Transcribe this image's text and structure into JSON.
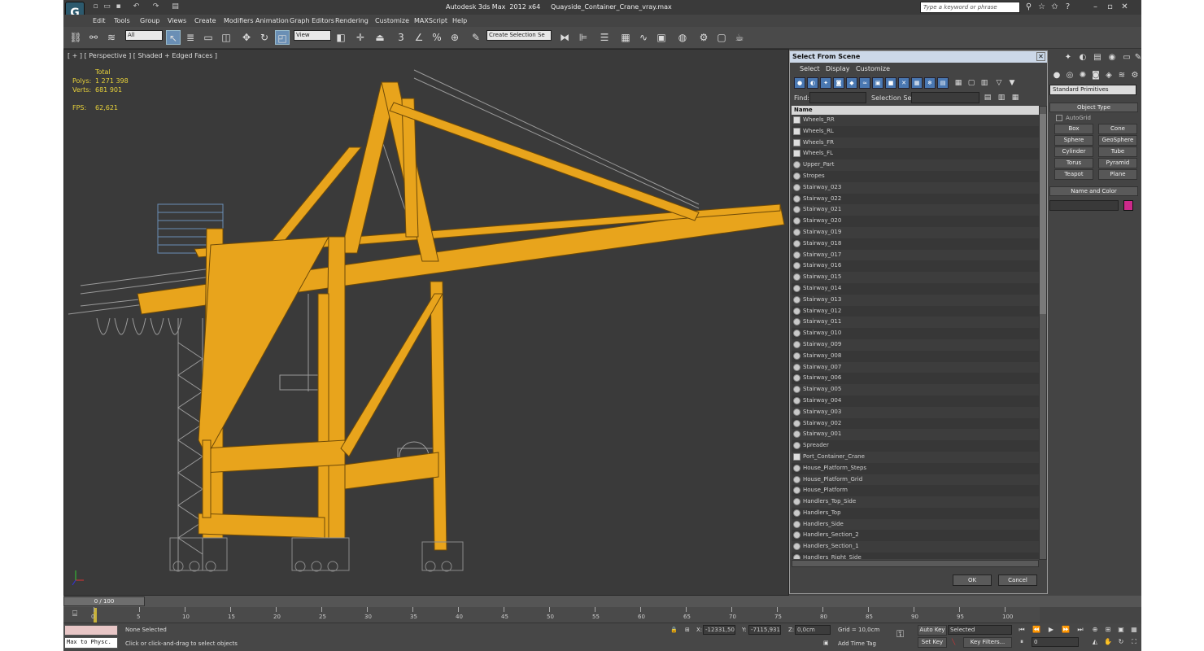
{
  "title": "Autodesk 3ds Max  2012 x64     Quayside_Container_Crane_vray.max",
  "search_placeholder": "Type a keyword or phrase",
  "menu": [
    "Edit",
    "Tools",
    "Group",
    "Views",
    "Create",
    "Modifiers",
    "Animation",
    "Graph Editors",
    "Rendering",
    "Customize",
    "MAXScript",
    "Help"
  ],
  "toolbar": {
    "filter": "All",
    "coord": "View",
    "selection_set": "Create Selection Se"
  },
  "viewport": {
    "label": "[ + ] [ Perspective ] [ Shaded + Edged Faces ]",
    "stats_total": "Total",
    "polys_label": "Polys:",
    "polys": "1 271 398",
    "verts_label": "Verts:",
    "verts": "681 901",
    "fps_label": "FPS:",
    "fps": "62,621"
  },
  "dialog": {
    "title": "Select From Scene",
    "menu": [
      "Select",
      "Display",
      "Customize"
    ],
    "find_label": "Find:",
    "selection_set_label": "Selection Set:",
    "column_name": "Name",
    "items": [
      {
        "name": "Wheels_RR",
        "group": true
      },
      {
        "name": "Wheels_RL",
        "group": true
      },
      {
        "name": "Wheels_FR",
        "group": true
      },
      {
        "name": "Wheels_FL",
        "group": true
      },
      {
        "name": "Upper_Part",
        "group": false
      },
      {
        "name": "Stropes",
        "group": false
      },
      {
        "name": "Stairway_023",
        "group": false
      },
      {
        "name": "Stairway_022",
        "group": false
      },
      {
        "name": "Stairway_021",
        "group": false
      },
      {
        "name": "Stairway_020",
        "group": false
      },
      {
        "name": "Stairway_019",
        "group": false
      },
      {
        "name": "Stairway_018",
        "group": false
      },
      {
        "name": "Stairway_017",
        "group": false
      },
      {
        "name": "Stairway_016",
        "group": false
      },
      {
        "name": "Stairway_015",
        "group": false
      },
      {
        "name": "Stairway_014",
        "group": false
      },
      {
        "name": "Stairway_013",
        "group": false
      },
      {
        "name": "Stairway_012",
        "group": false
      },
      {
        "name": "Stairway_011",
        "group": false
      },
      {
        "name": "Stairway_010",
        "group": false
      },
      {
        "name": "Stairway_009",
        "group": false
      },
      {
        "name": "Stairway_008",
        "group": false
      },
      {
        "name": "Stairway_007",
        "group": false
      },
      {
        "name": "Stairway_006",
        "group": false
      },
      {
        "name": "Stairway_005",
        "group": false
      },
      {
        "name": "Stairway_004",
        "group": false
      },
      {
        "name": "Stairway_003",
        "group": false
      },
      {
        "name": "Stairway_002",
        "group": false
      },
      {
        "name": "Stairway_001",
        "group": false
      },
      {
        "name": "Spreader",
        "group": false
      },
      {
        "name": "Port_Container_Crane",
        "group": true
      },
      {
        "name": "House_Platform_Steps",
        "group": false
      },
      {
        "name": "House_Platform_Grid",
        "group": false
      },
      {
        "name": "House_Platform",
        "group": false
      },
      {
        "name": "Handlers_Top_Side",
        "group": false
      },
      {
        "name": "Handlers_Top",
        "group": false
      },
      {
        "name": "Handlers_Side",
        "group": false
      },
      {
        "name": "Handlers_Section_2",
        "group": false
      },
      {
        "name": "Handlers_Section_1",
        "group": false
      },
      {
        "name": "Handlers_Right_Side",
        "group": false
      }
    ],
    "ok": "OK",
    "cancel": "Cancel"
  },
  "command_panel": {
    "primitives": "Standard Primitives",
    "object_type": "Object Type",
    "autogrid": "AutoGrid",
    "buttons": [
      "Box",
      "Cone",
      "Sphere",
      "GeoSphere",
      "Cylinder",
      "Tube",
      "Torus",
      "Pyramid",
      "Teapot",
      "Plane"
    ],
    "name_and_color": "Name and Color",
    "color": "#cc2a8a"
  },
  "timeline": {
    "frame": "0 / 100",
    "ticks": [
      "0",
      "5",
      "10",
      "15",
      "20",
      "25",
      "30",
      "35",
      "40",
      "45",
      "50",
      "55",
      "60",
      "65",
      "70",
      "75",
      "80",
      "85",
      "90",
      "95",
      "100"
    ]
  },
  "status": {
    "maxscript": "Max to Physc.",
    "selected": "None Selected",
    "prompt": "Click or click-and-drag to select objects",
    "x_label": "X:",
    "x": "-12331,50",
    "y_label": "Y:",
    "y": "-7115,931",
    "z_label": "Z:",
    "z": "0,0cm",
    "grid": "Grid = 10,0cm",
    "add_time_tag": "Add Time Tag",
    "auto_key": "Auto Key",
    "selected_dd": "Selected",
    "set_key": "Set Key",
    "key_filters": "Key Filters...",
    "current_frame": "0"
  },
  "colors": {
    "crane_yellow": "#e8a41c",
    "wire_grey": "#9a9a9a",
    "selection_blue": "#4a78b2"
  }
}
